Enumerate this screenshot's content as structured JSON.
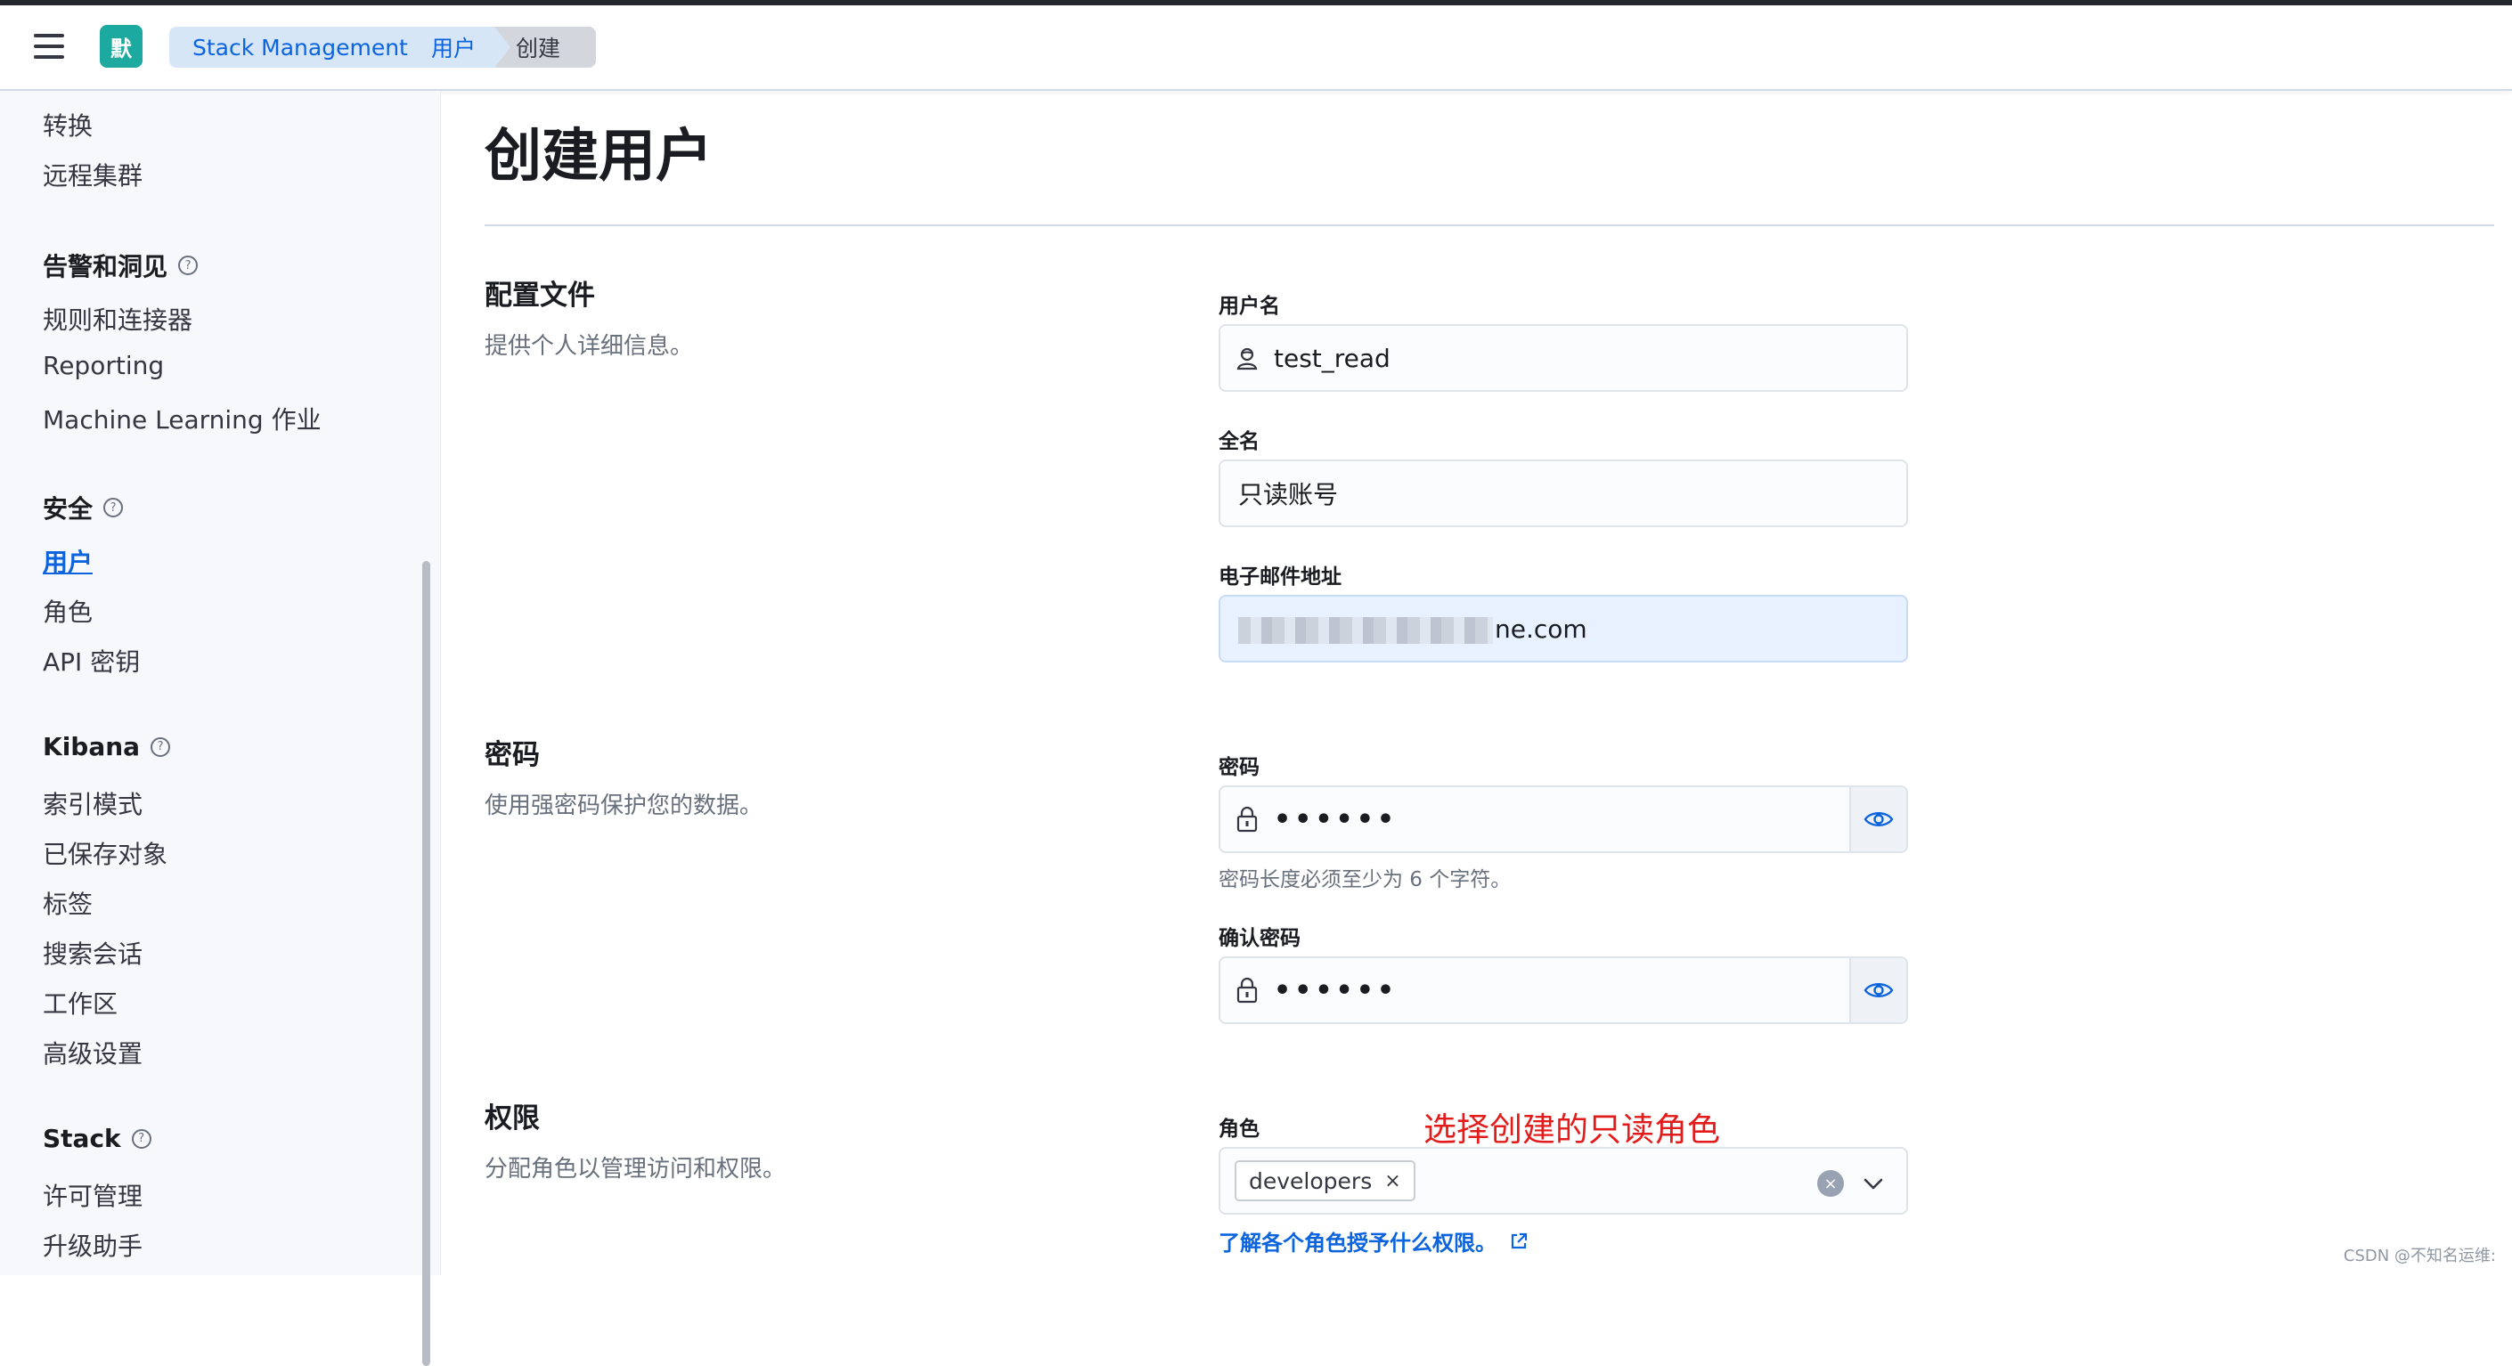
{
  "header": {
    "space_initial": "默",
    "breadcrumbs": [
      "Stack Management",
      "用户",
      "创建"
    ]
  },
  "sidebar": {
    "items_top": [
      "转换",
      "远程集群"
    ],
    "groups": [
      {
        "title": "告警和洞见",
        "items": [
          "规则和连接器",
          "Reporting",
          "Machine Learning 作业"
        ]
      },
      {
        "title": "安全",
        "items": [
          "用户",
          "角色",
          "API 密钥"
        ],
        "active": "用户"
      },
      {
        "title": "Kibana",
        "items": [
          "索引模式",
          "已保存对象",
          "标签",
          "搜索会话",
          "工作区",
          "高级设置"
        ]
      },
      {
        "title": "Stack",
        "items": [
          "许可管理",
          "升级助手"
        ]
      }
    ],
    "help_glyph": "?"
  },
  "page": {
    "title": "创建用户",
    "sections": {
      "profile": {
        "title": "配置文件",
        "desc": "提供个人详细信息。"
      },
      "password": {
        "title": "密码",
        "desc": "使用强密码保护您的数据。"
      },
      "privileges": {
        "title": "权限",
        "desc": "分配角色以管理访问和权限。"
      }
    },
    "fields": {
      "username": {
        "label": "用户名",
        "value": "test_read",
        "icon": "user-icon"
      },
      "fullname": {
        "label": "全名",
        "value": "只读账号"
      },
      "email": {
        "label": "电子邮件地址",
        "value_visible_suffix": "ne.com",
        "obscured": true
      },
      "password": {
        "label": "密码",
        "value": "••••••",
        "help": "密码长度必须至少为 6 个字符。",
        "icon": "lock-icon"
      },
      "confirm_password": {
        "label": "确认密码",
        "value": "••••••",
        "icon": "lock-icon"
      },
      "roles": {
        "label": "角色",
        "selected": [
          "developers"
        ],
        "remove_glyph": "×",
        "clear_glyph": "×"
      }
    },
    "annotation": "选择创建的只读角色",
    "learn_link": "了解各个角色授予什么权限。"
  },
  "watermark": "CSDN @不知名运维:",
  "colors": {
    "accent": "#0b64dd",
    "annotation": "#e21b1b",
    "space_avatar": "#1ba9a0"
  }
}
